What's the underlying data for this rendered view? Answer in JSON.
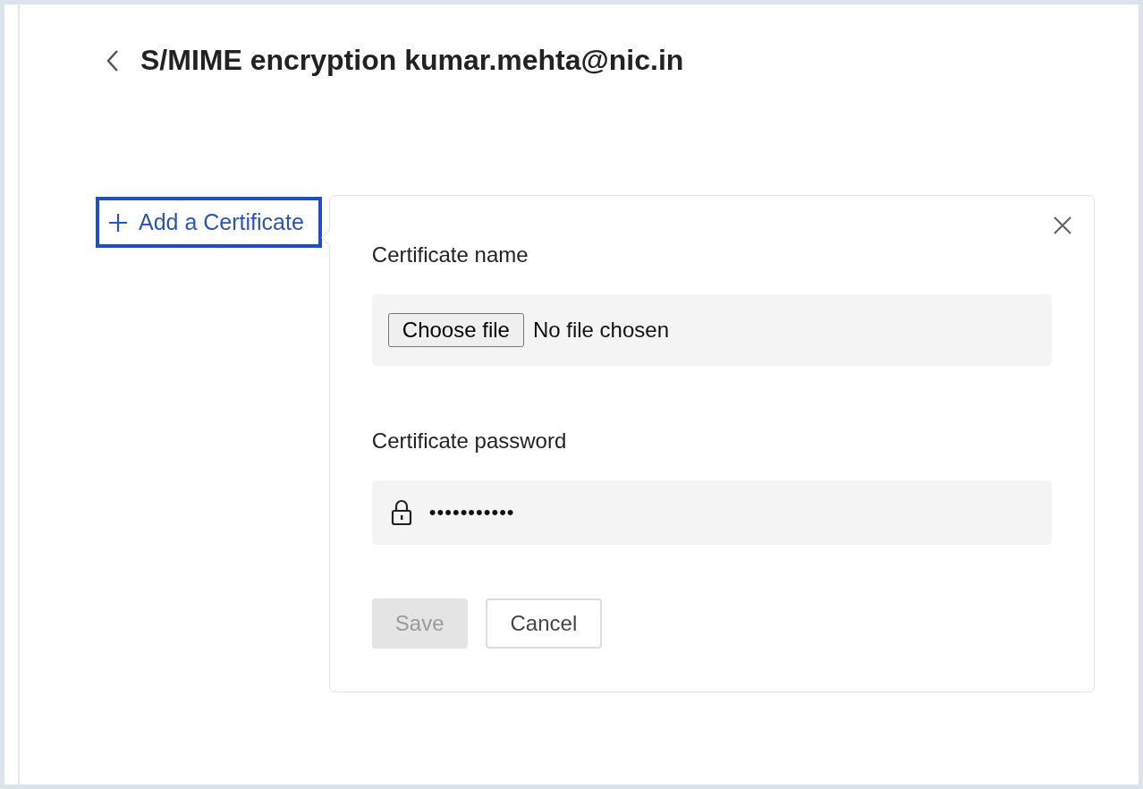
{
  "header": {
    "title": "S/MIME encryption kumar.mehta@nic.in"
  },
  "add_button": {
    "label": "Add a Certificate",
    "selected": true
  },
  "dialog": {
    "certificate_name": {
      "label": "Certificate name",
      "button": "Choose file",
      "status": "No file chosen"
    },
    "certificate_password": {
      "label": "Certificate password",
      "value": "•••••••••••"
    },
    "buttons": [
      {
        "label": "Save",
        "kind": "primary",
        "disabled": true
      },
      {
        "label": "Cancel",
        "kind": "secondary",
        "disabled": false
      }
    ]
  }
}
